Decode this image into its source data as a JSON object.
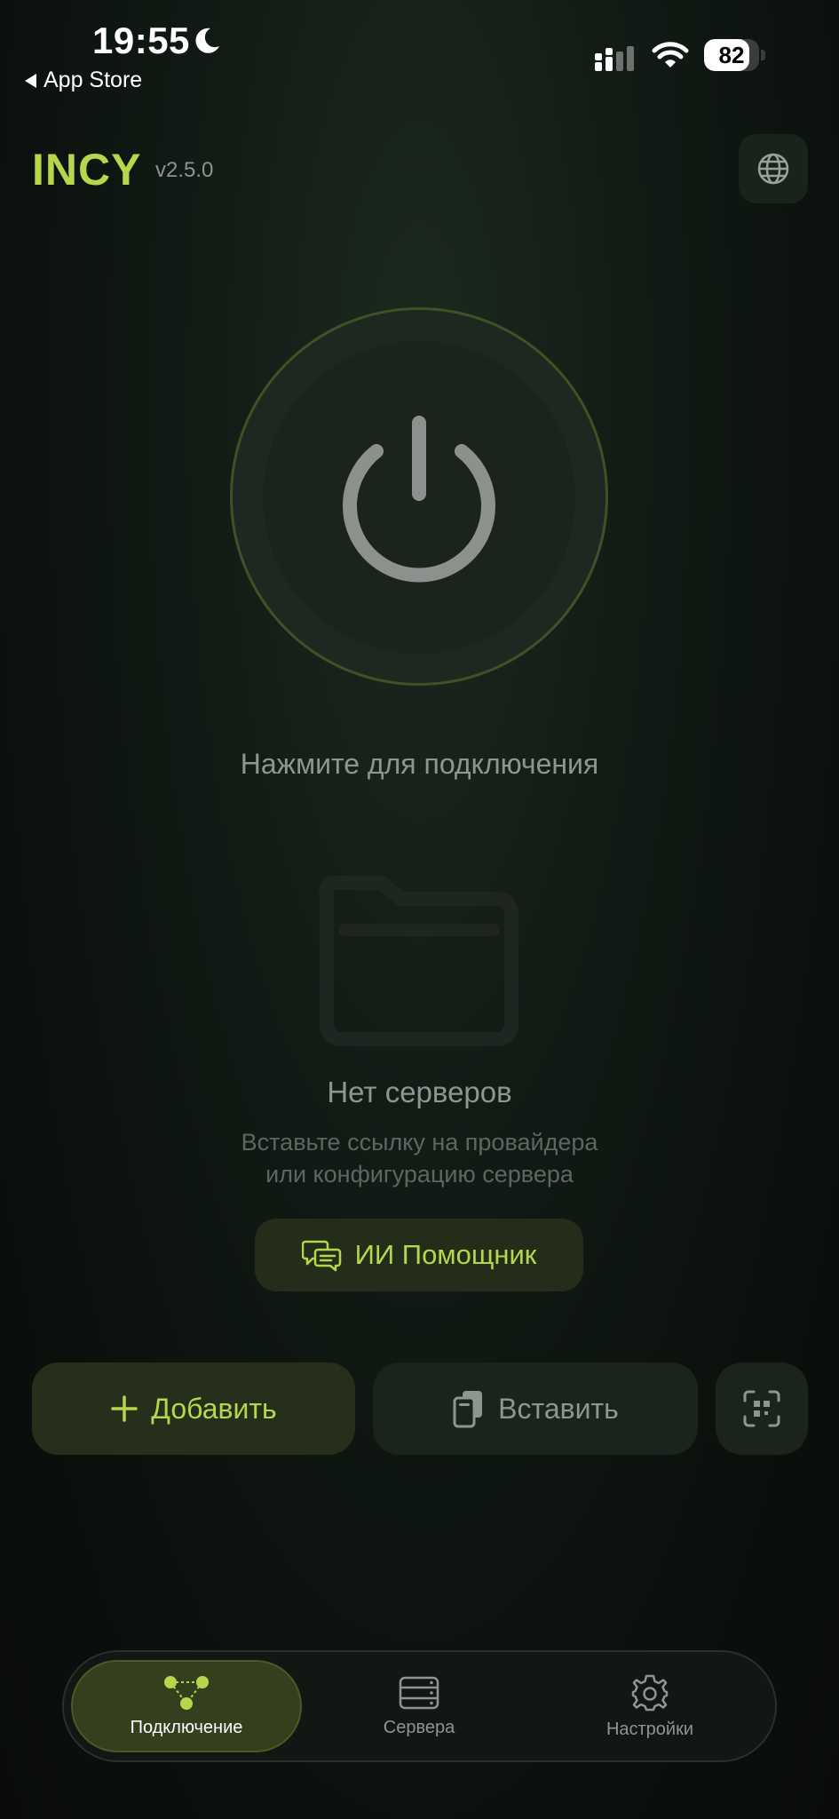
{
  "status_bar": {
    "time": "19:55",
    "back_label": "App Store",
    "battery": "82"
  },
  "header": {
    "brand": "INCY",
    "version": "v2.5.0"
  },
  "power": {
    "hint": "Нажмите для подключения"
  },
  "empty_state": {
    "title": "Нет серверов",
    "description_line1": "Вставьте ссылку на провайдера",
    "description_line2": "или конфигурацию сервера"
  },
  "ai_button": {
    "label": "ИИ Помощник"
  },
  "actions": {
    "add_label": "Добавить",
    "paste_label": "Вставить"
  },
  "tabs": [
    {
      "label": "Подключение",
      "icon": "connection-icon",
      "active": true
    },
    {
      "label": "Сервера",
      "icon": "server-icon",
      "active": false
    },
    {
      "label": "Настройки",
      "icon": "gear-icon",
      "active": false
    }
  ],
  "colors": {
    "accent": "#b6d64b",
    "background": "#0e1410",
    "muted_text": "#8f9590"
  }
}
